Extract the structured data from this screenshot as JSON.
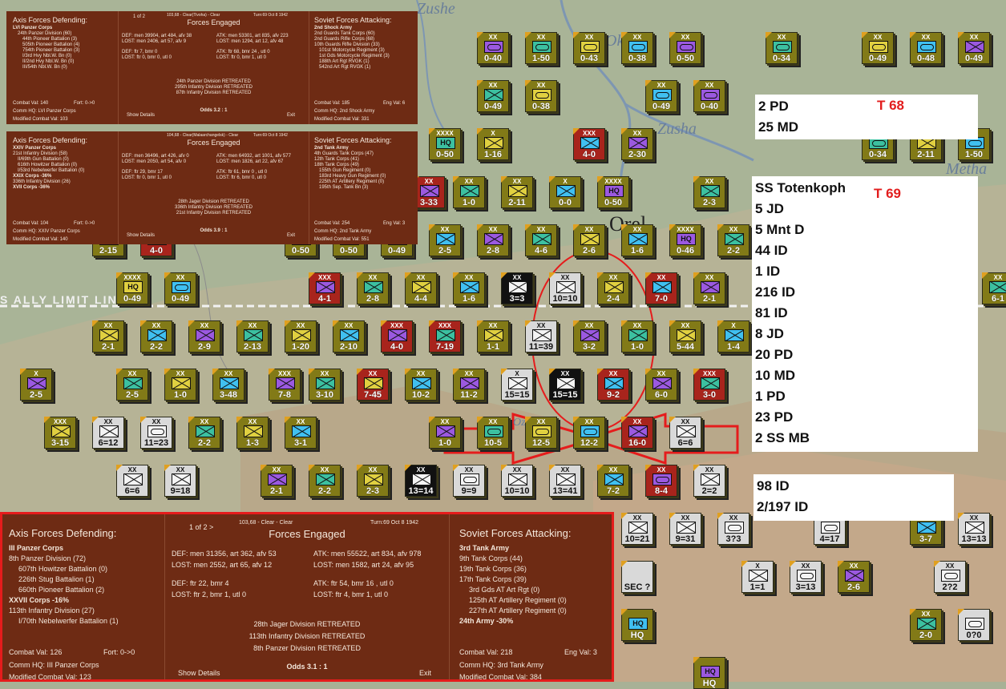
{
  "map": {
    "place_labels": [
      "Zushe",
      "Zusha",
      "Oka",
      "Metha",
      "Orel",
      "Ozerna"
    ],
    "limit_line_text": "S ALLY LIMIT LIN",
    "colors": {
      "terrain": "#a8b196",
      "soviet": "#827a17",
      "soviet_red": "#a8241c",
      "axis": "#d9d9d9",
      "panel": "#6e2b14",
      "highlight": "#e51c1c"
    },
    "units": [
      {
        "size": "XX",
        "val": "0-40",
        "type": "arm"
      },
      {
        "size": "XX",
        "val": "1-50",
        "type": "arm"
      },
      {
        "size": "XX",
        "val": "0-43",
        "type": "arm"
      },
      {
        "size": "XX",
        "val": "0-38",
        "type": "arm"
      },
      {
        "size": "XX",
        "val": "0-50",
        "type": "arm"
      },
      {
        "size": "XX",
        "val": "0-34",
        "type": "arm"
      },
      {
        "size": "XX",
        "val": "0-49",
        "type": "arm"
      },
      {
        "size": "XX",
        "val": "0-48",
        "type": "arm"
      },
      {
        "size": "XX",
        "val": "0-49",
        "type": "inf"
      },
      {
        "size": "XX",
        "val": "0-49",
        "type": "inf"
      },
      {
        "size": "XX",
        "val": "0-38",
        "type": "arm"
      },
      {
        "size": "XX",
        "val": "0-49",
        "type": "arm"
      },
      {
        "size": "XX",
        "val": "0-40",
        "type": "arm"
      },
      {
        "size": "XXXX",
        "val": "0-50",
        "type": "hq"
      },
      {
        "size": "X",
        "val": "1-16",
        "type": "inf"
      },
      {
        "size": "XXX",
        "val": "4-0",
        "type": "inf"
      },
      {
        "size": "XX",
        "val": "2-30",
        "type": "inf"
      },
      {
        "size": "XX",
        "val": "0-34",
        "type": "arm"
      },
      {
        "size": "XX",
        "val": "2-11",
        "type": "inf"
      },
      {
        "size": "XX",
        "val": "1-50",
        "type": "arm"
      },
      {
        "size": "XX",
        "val": "3-33",
        "type": "inf"
      },
      {
        "size": "XX",
        "val": "1-0",
        "type": "inf"
      },
      {
        "size": "XX",
        "val": "2-11",
        "type": "inf"
      },
      {
        "size": "X",
        "val": "0-0",
        "type": "inf"
      },
      {
        "size": "XXXX",
        "val": "0-50",
        "type": "hq"
      },
      {
        "size": "XX",
        "val": "2-3",
        "type": "inf"
      },
      {
        "size": "XX",
        "val": "2-15",
        "type": "inf"
      },
      {
        "size": "XX",
        "val": "4-0",
        "type": "inf"
      },
      {
        "size": "XX",
        "val": "0-50",
        "type": "arm"
      },
      {
        "size": "XX",
        "val": "0-50",
        "type": "arm"
      },
      {
        "size": "XX",
        "val": "0-49",
        "type": "arm"
      },
      {
        "size": "XX",
        "val": "2-5",
        "type": "inf"
      },
      {
        "size": "XX",
        "val": "2-8",
        "type": "inf"
      },
      {
        "size": "XX",
        "val": "4-6",
        "type": "inf"
      },
      {
        "size": "XX",
        "val": "2-6",
        "type": "inf"
      },
      {
        "size": "XX",
        "val": "1-6",
        "type": "inf"
      },
      {
        "size": "XXXX",
        "val": "0-46",
        "type": "hq"
      },
      {
        "size": "XX",
        "val": "2-2",
        "type": "inf"
      },
      {
        "size": "XXXX",
        "val": "0-49",
        "type": "hq"
      },
      {
        "size": "XX",
        "val": "0-49",
        "type": "arm"
      },
      {
        "size": "XXX",
        "val": "4-1",
        "type": "inf"
      },
      {
        "size": "XX",
        "val": "2-8",
        "type": "inf"
      },
      {
        "size": "XX",
        "val": "4-4",
        "type": "inf"
      },
      {
        "size": "XX",
        "val": "1-6",
        "type": "inf"
      },
      {
        "size": "XX",
        "val": "3=3",
        "type": "inf"
      },
      {
        "size": "XX",
        "val": "10=10",
        "type": "inf"
      },
      {
        "size": "XX",
        "val": "2-4",
        "type": "inf"
      },
      {
        "size": "XX",
        "val": "7-0",
        "type": "inf"
      },
      {
        "size": "XX",
        "val": "2-1",
        "type": "inf"
      },
      {
        "size": "XX",
        "val": "6-1",
        "type": "inf"
      },
      {
        "size": "XX",
        "val": "2-1",
        "type": "inf"
      },
      {
        "size": "XX",
        "val": "2-2",
        "type": "inf"
      },
      {
        "size": "XX",
        "val": "2-9",
        "type": "inf"
      },
      {
        "size": "XX",
        "val": "2-13",
        "type": "inf"
      },
      {
        "size": "XX",
        "val": "1-20",
        "type": "inf"
      },
      {
        "size": "XX",
        "val": "2-10",
        "type": "inf"
      },
      {
        "size": "XXX",
        "val": "4-0",
        "type": "inf"
      },
      {
        "size": "XXX",
        "val": "7-19",
        "type": "inf"
      },
      {
        "size": "XX",
        "val": "1-1",
        "type": "inf"
      },
      {
        "size": "XX",
        "val": "11=39",
        "type": "inf"
      },
      {
        "size": "XX",
        "val": "3-2",
        "type": "inf"
      },
      {
        "size": "XX",
        "val": "1-0",
        "type": "inf"
      },
      {
        "size": "XX",
        "val": "5-44",
        "type": "inf"
      },
      {
        "size": "X",
        "val": "1-4",
        "type": "inf"
      },
      {
        "size": "X",
        "val": "2-5",
        "type": "inf"
      },
      {
        "size": "XX",
        "val": "2-5",
        "type": "inf"
      },
      {
        "size": "XX",
        "val": "1-0",
        "type": "inf"
      },
      {
        "size": "XX",
        "val": "3-48",
        "type": "inf"
      },
      {
        "size": "XXX",
        "val": "7-8",
        "type": "inf"
      },
      {
        "size": "XX",
        "val": "3-10",
        "type": "inf"
      },
      {
        "size": "XX",
        "val": "7-45",
        "type": "inf"
      },
      {
        "size": "XX",
        "val": "10-2",
        "type": "inf"
      },
      {
        "size": "XX",
        "val": "11-2",
        "type": "inf"
      },
      {
        "size": "X",
        "val": "15=15",
        "type": "inf"
      },
      {
        "size": "XX",
        "val": "15=15",
        "type": "inf"
      },
      {
        "size": "XX",
        "val": "9-2",
        "type": "inf"
      },
      {
        "size": "XX",
        "val": "6-0",
        "type": "inf"
      },
      {
        "size": "XXX",
        "val": "3-0",
        "type": "inf"
      },
      {
        "size": "XXX",
        "val": "3-15",
        "type": "inf"
      },
      {
        "size": "XX",
        "val": "6=12",
        "type": "inf"
      },
      {
        "size": "XX",
        "val": "11=23",
        "type": "arm"
      },
      {
        "size": "XX",
        "val": "2-2",
        "type": "inf"
      },
      {
        "size": "XX",
        "val": "1-3",
        "type": "inf"
      },
      {
        "size": "XX",
        "val": "3-1",
        "type": "inf"
      },
      {
        "size": "XX",
        "val": "1-0",
        "type": "inf"
      },
      {
        "size": "XX",
        "val": "10-5",
        "type": "arm"
      },
      {
        "size": "XX",
        "val": "12-5",
        "type": "arm"
      },
      {
        "size": "XX",
        "val": "12-2",
        "type": "arm"
      },
      {
        "size": "XX",
        "val": "16-0",
        "type": "inf"
      },
      {
        "size": "XX",
        "val": "6=6",
        "type": "inf"
      },
      {
        "size": "XX",
        "val": "6=6",
        "type": "inf"
      },
      {
        "size": "XX",
        "val": "9=18",
        "type": "inf"
      },
      {
        "size": "XX",
        "val": "2-1",
        "type": "inf"
      },
      {
        "size": "XX",
        "val": "2-2",
        "type": "inf"
      },
      {
        "size": "XX",
        "val": "2-3",
        "type": "inf"
      },
      {
        "size": "XX",
        "val": "13=14",
        "type": "inf"
      },
      {
        "size": "XX",
        "val": "9=9",
        "type": "arm"
      },
      {
        "size": "XX",
        "val": "10=10",
        "type": "inf"
      },
      {
        "size": "XX",
        "val": "13=41",
        "type": "inf"
      },
      {
        "size": "XX",
        "val": "7-2",
        "type": "inf"
      },
      {
        "size": "XX",
        "val": "8-4",
        "type": "arm"
      },
      {
        "size": "XX",
        "val": "2=2",
        "type": "inf"
      },
      {
        "size": "XX",
        "val": "4=17",
        "type": "arm"
      },
      {
        "size": "XX",
        "val": "3-7",
        "type": "inf"
      },
      {
        "size": "XX",
        "val": "13=13",
        "type": "inf"
      },
      {
        "size": "XX",
        "val": "10=21",
        "type": "inf"
      },
      {
        "size": "XX",
        "val": "9=31",
        "type": "inf"
      },
      {
        "size": "XX",
        "val": "3?3",
        "type": "arm"
      },
      {
        "size": "X",
        "val": "1=1",
        "type": "inf"
      },
      {
        "size": "XX",
        "val": "3=13",
        "type": "arm"
      },
      {
        "size": "XX",
        "val": "2?2",
        "type": "arm"
      },
      {
        "size": "",
        "val": "SEC ?",
        "type": "none"
      },
      {
        "size": "XX",
        "val": "2-6",
        "type": "inf"
      },
      {
        "size": "XX",
        "val": "2-0",
        "type": "inf"
      },
      {
        "size": "",
        "val": "0?0",
        "type": "arm"
      },
      {
        "size": "",
        "val": "HQ",
        "type": "hq"
      },
      {
        "size": "",
        "val": "HQ",
        "type": "hq"
      }
    ]
  },
  "panels": [
    {
      "nav": "1 of 2",
      "meta": "103,68 - Clear(Tivoha) - Clear",
      "turn": "Turn:69  Oct 8 1942",
      "axis_title": "Axis Forces Defending:",
      "axis_lines": [
        {
          "t": "LVI Panzer Corps",
          "c": "bold"
        },
        {
          "t": "24th Panzer Division (60)",
          "c": "indent1"
        },
        {
          "t": "44th Pioneer Battalion (3)",
          "c": "indent2"
        },
        {
          "t": "505th Pioneer Battalion (4)",
          "c": "indent2"
        },
        {
          "t": "754th Pioneer Battalion (3)",
          "c": "indent2"
        },
        {
          "t": "I/3rd Hvy Nbl.W. Bn (0)",
          "c": "indent2"
        },
        {
          "t": "II/2nd Hvy Nbl.W. Bn (0)",
          "c": "indent2"
        },
        {
          "t": "III/54th Nbl.W. Bn (0)",
          "c": "indent2"
        }
      ],
      "axis_foot": [
        "Combat Val: 140",
        "Fort: 0->0",
        "Comm HQ: LVI Panzer Corps",
        "Modified Combat Val: 103"
      ],
      "mid_title": "Forces Engaged",
      "stats_left": [
        "DEF: men 39904, art 484, afv 38",
        "LOST: men 2406, art 57, afv 9",
        "",
        "DEF: ftr 7, bmr 0",
        "LOST: ftr 0, bmr 0, utl 0"
      ],
      "stats_right": [
        "ATK: men 53301, art 835, afv 223",
        "LOST: men 1294, art 12, afv 48",
        "",
        "ATK: ftr 68, bmr 24 , utl 0",
        "LOST: ftr 0, bmr 1, utl 0"
      ],
      "results": [
        "24th Panzer Division RETREATED",
        "295th Infantry Division RETREATED",
        "87th Infantry Division RETREATED"
      ],
      "odds": "Odds 3.2 : 1",
      "show_details": "Show Details",
      "exit": "Exit",
      "sov_title": "Soviet Forces Attacking:",
      "sov_lines": [
        {
          "t": "2nd Shock Army",
          "c": "bold"
        },
        {
          "t": "2nd Guards Tank Corps (60)",
          "c": ""
        },
        {
          "t": "2nd Guards Rifle Corps (68)",
          "c": ""
        },
        {
          "t": "10th Guards Rifle Division (33)",
          "c": ""
        },
        {
          "t": "101st Motorcycle Regiment (3)",
          "c": "indent1"
        },
        {
          "t": "1st Gds Motorcycle Regiment (3)",
          "c": "indent1"
        },
        {
          "t": "188th Art Rgt RVGK (1)",
          "c": "indent1"
        },
        {
          "t": "542nd Art Rgt RVGK (1)",
          "c": "indent1"
        }
      ],
      "sov_foot": [
        "Combat Val: 185",
        "Eng Val: 6",
        "Comm HQ: 2nd Shock Army",
        "Modified Combat Val: 331"
      ]
    },
    {
      "nav": "",
      "meta": "104,68 - Clear(Malaarchangelsk) - Clear",
      "turn": "Turn:69  Oct 8 1942",
      "axis_title": "Axis Forces Defending:",
      "axis_lines": [
        {
          "t": "XXIV Panzer Corps",
          "c": "bold"
        },
        {
          "t": "21st Infantry Division (58)",
          "c": ""
        },
        {
          "t": "II/69th Gun Battalion (0)",
          "c": "indent1"
        },
        {
          "t": "616th Howitzer Battalion (0)",
          "c": "indent1"
        },
        {
          "t": "I/53rd Nebelwerfer Battalion (0)",
          "c": "indent1"
        },
        {
          "t": "XXIX Corps  -36%",
          "c": "bold"
        },
        {
          "t": "336th Infantry Division (26)",
          "c": ""
        },
        {
          "t": "XVII Corps  -36%",
          "c": "bold"
        }
      ],
      "axis_foot": [
        "Combat Val: 104",
        "Fort: 0->0",
        "Comm HQ: XXIV Panzer Corps",
        "Modified Combat Val: 140"
      ],
      "mid_title": "Forces Engaged",
      "stats_left": [
        "DEF: men 36496, art 426, afv 0",
        "LOST: men 2050, art 54, afv 0",
        "",
        "DEF: ftr 29, bmr 17",
        "LOST: ftr 0, bmr 1, utl 0"
      ],
      "stats_right": [
        "ATK: men 64932, art 1001, afv 577",
        "LOST: men 1826, art 22, afv 67",
        "",
        "ATK: ftr 61, bmr 0 , utl 0",
        "LOST: ftr 6, bmr 0, utl 0"
      ],
      "results": [
        "28th Jager Division RETREATED",
        "336th Infantry Division RETREATED",
        "21st Infantry Division RETREATED"
      ],
      "odds": "Odds 3.9 : 1",
      "show_details": "Show Details",
      "exit": "Exit",
      "sov_title": "Soviet Forces Attacking:",
      "sov_lines": [
        {
          "t": "2nd Tank Army",
          "c": "bold"
        },
        {
          "t": "4th Guards Tank Corps (47)",
          "c": ""
        },
        {
          "t": "12th Tank Corps (41)",
          "c": ""
        },
        {
          "t": "18th Tank Corps (49)",
          "c": ""
        },
        {
          "t": "155th Gun Regiment (0)",
          "c": "indent1"
        },
        {
          "t": "183rd Heavy Gun Regiment (0)",
          "c": "indent1"
        },
        {
          "t": "225th AT Artillery Regiment (0)",
          "c": "indent1"
        },
        {
          "t": "195th Sep. Tank Bn (3)",
          "c": "indent1"
        }
      ],
      "sov_foot": [
        "Combat Val: 254",
        "Eng Val: 3",
        "Comm HQ: 2nd Tank Army",
        "Modified Combat Val: 551"
      ]
    },
    {
      "nav": "1 of 2  >",
      "meta": "103,68 - Clear - Clear",
      "turn": "Turn:69  Oct 8 1942",
      "axis_title": "Axis Forces Defending:",
      "axis_lines": [
        {
          "t": "III Panzer Corps",
          "c": "bold"
        },
        {
          "t": "8th Panzer Division (72)",
          "c": ""
        },
        {
          "t": "607th Howitzer Battalion (0)",
          "c": "indent2"
        },
        {
          "t": "226th Stug Battalion (1)",
          "c": "indent2"
        },
        {
          "t": "660th Pioneer Battalion (2)",
          "c": "indent2"
        },
        {
          "t": "XXVII Corps  -16%",
          "c": "bold"
        },
        {
          "t": "113th Infantry Division (27)",
          "c": ""
        },
        {
          "t": "I/70th Nebelwerfer Battalion (1)",
          "c": "indent2"
        }
      ],
      "axis_foot": [
        "Combat Val: 126",
        "Fort: 0->0",
        "Comm HQ: III Panzer Corps",
        "Modified Combat Val: 123"
      ],
      "mid_title": "Forces Engaged",
      "stats_left": [
        "DEF: men 31356, art 362, afv 53",
        "LOST: men 2552, art 65, afv 12",
        "",
        "DEF: ftr 22, bmr 4",
        "LOST: ftr 2, bmr 1, utl 0"
      ],
      "stats_right": [
        "ATK: men 55522, art 834, afv 978",
        "LOST: men 1582, art 24, afv 95",
        "",
        "ATK: ftr 54, bmr 16 , utl 0",
        "LOST: ftr 4, bmr 1, utl 0"
      ],
      "results": [
        "28th Jager Division RETREATED",
        "113th Infantry Division RETREATED",
        "8th Panzer Division RETREATED"
      ],
      "odds": "Odds 3.1 : 1",
      "show_details": "Show Details",
      "exit": "Exit",
      "sov_title": "Soviet Forces Attacking:",
      "sov_lines": [
        {
          "t": "3rd Tank Army",
          "c": "bold"
        },
        {
          "t": "9th Tank Corps (44)",
          "c": ""
        },
        {
          "t": "19th Tank Corps (36)",
          "c": ""
        },
        {
          "t": "17th Tank Corps (39)",
          "c": ""
        },
        {
          "t": "3rd Gds AT Art Rgt (0)",
          "c": "indent2"
        },
        {
          "t": "125th AT Artillery Regiment (0)",
          "c": "indent2"
        },
        {
          "t": "227th AT Artillery Regiment (0)",
          "c": "indent2"
        },
        {
          "t": "24th Army  -30%",
          "c": "bold"
        }
      ],
      "sov_foot": [
        "Combat Val: 218",
        "Eng Val: 3",
        "Comm HQ: 3rd Tank Army",
        "Modified Combat Val: 384"
      ]
    }
  ],
  "notes": [
    {
      "turn": "T 68",
      "items": [
        "2 PD",
        "25 MD"
      ]
    },
    {
      "turn": "T 69",
      "items": [
        "SS Totenkoph",
        "5 JD",
        "5 Mnt D",
        "44 ID",
        "1 ID",
        "216 ID",
        "81 ID",
        "8 JD",
        "20 PD",
        "10 MD",
        "1 PD",
        "23 PD",
        "2 SS MB"
      ]
    },
    {
      "turn": "",
      "items": [
        "98 ID",
        "2/197 ID"
      ]
    }
  ]
}
